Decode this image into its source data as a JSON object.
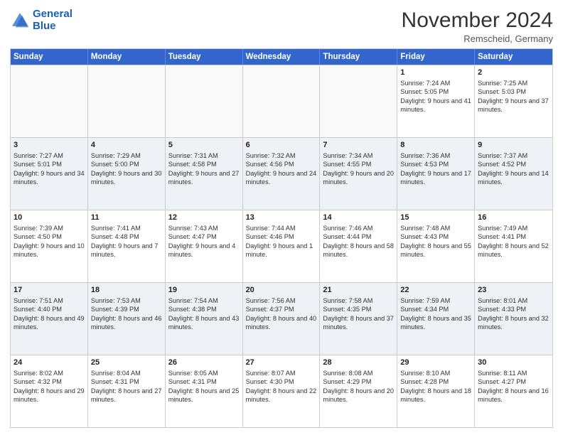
{
  "logo": {
    "line1": "General",
    "line2": "Blue"
  },
  "header": {
    "month": "November 2024",
    "location": "Remscheid, Germany"
  },
  "weekdays": [
    "Sunday",
    "Monday",
    "Tuesday",
    "Wednesday",
    "Thursday",
    "Friday",
    "Saturday"
  ],
  "rows": [
    [
      {
        "day": "",
        "info": "",
        "empty": true
      },
      {
        "day": "",
        "info": "",
        "empty": true
      },
      {
        "day": "",
        "info": "",
        "empty": true
      },
      {
        "day": "",
        "info": "",
        "empty": true
      },
      {
        "day": "",
        "info": "",
        "empty": true
      },
      {
        "day": "1",
        "info": "Sunrise: 7:24 AM\nSunset: 5:05 PM\nDaylight: 9 hours and 41 minutes."
      },
      {
        "day": "2",
        "info": "Sunrise: 7:25 AM\nSunset: 5:03 PM\nDaylight: 9 hours and 37 minutes."
      }
    ],
    [
      {
        "day": "3",
        "info": "Sunrise: 7:27 AM\nSunset: 5:01 PM\nDaylight: 9 hours and 34 minutes."
      },
      {
        "day": "4",
        "info": "Sunrise: 7:29 AM\nSunset: 5:00 PM\nDaylight: 9 hours and 30 minutes."
      },
      {
        "day": "5",
        "info": "Sunrise: 7:31 AM\nSunset: 4:58 PM\nDaylight: 9 hours and 27 minutes."
      },
      {
        "day": "6",
        "info": "Sunrise: 7:32 AM\nSunset: 4:56 PM\nDaylight: 9 hours and 24 minutes."
      },
      {
        "day": "7",
        "info": "Sunrise: 7:34 AM\nSunset: 4:55 PM\nDaylight: 9 hours and 20 minutes."
      },
      {
        "day": "8",
        "info": "Sunrise: 7:36 AM\nSunset: 4:53 PM\nDaylight: 9 hours and 17 minutes."
      },
      {
        "day": "9",
        "info": "Sunrise: 7:37 AM\nSunset: 4:52 PM\nDaylight: 9 hours and 14 minutes."
      }
    ],
    [
      {
        "day": "10",
        "info": "Sunrise: 7:39 AM\nSunset: 4:50 PM\nDaylight: 9 hours and 10 minutes."
      },
      {
        "day": "11",
        "info": "Sunrise: 7:41 AM\nSunset: 4:48 PM\nDaylight: 9 hours and 7 minutes."
      },
      {
        "day": "12",
        "info": "Sunrise: 7:43 AM\nSunset: 4:47 PM\nDaylight: 9 hours and 4 minutes."
      },
      {
        "day": "13",
        "info": "Sunrise: 7:44 AM\nSunset: 4:46 PM\nDaylight: 9 hours and 1 minute."
      },
      {
        "day": "14",
        "info": "Sunrise: 7:46 AM\nSunset: 4:44 PM\nDaylight: 8 hours and 58 minutes."
      },
      {
        "day": "15",
        "info": "Sunrise: 7:48 AM\nSunset: 4:43 PM\nDaylight: 8 hours and 55 minutes."
      },
      {
        "day": "16",
        "info": "Sunrise: 7:49 AM\nSunset: 4:41 PM\nDaylight: 8 hours and 52 minutes."
      }
    ],
    [
      {
        "day": "17",
        "info": "Sunrise: 7:51 AM\nSunset: 4:40 PM\nDaylight: 8 hours and 49 minutes."
      },
      {
        "day": "18",
        "info": "Sunrise: 7:53 AM\nSunset: 4:39 PM\nDaylight: 8 hours and 46 minutes."
      },
      {
        "day": "19",
        "info": "Sunrise: 7:54 AM\nSunset: 4:38 PM\nDaylight: 8 hours and 43 minutes."
      },
      {
        "day": "20",
        "info": "Sunrise: 7:56 AM\nSunset: 4:37 PM\nDaylight: 8 hours and 40 minutes."
      },
      {
        "day": "21",
        "info": "Sunrise: 7:58 AM\nSunset: 4:35 PM\nDaylight: 8 hours and 37 minutes."
      },
      {
        "day": "22",
        "info": "Sunrise: 7:59 AM\nSunset: 4:34 PM\nDaylight: 8 hours and 35 minutes."
      },
      {
        "day": "23",
        "info": "Sunrise: 8:01 AM\nSunset: 4:33 PM\nDaylight: 8 hours and 32 minutes."
      }
    ],
    [
      {
        "day": "24",
        "info": "Sunrise: 8:02 AM\nSunset: 4:32 PM\nDaylight: 8 hours and 29 minutes."
      },
      {
        "day": "25",
        "info": "Sunrise: 8:04 AM\nSunset: 4:31 PM\nDaylight: 8 hours and 27 minutes."
      },
      {
        "day": "26",
        "info": "Sunrise: 8:05 AM\nSunset: 4:31 PM\nDaylight: 8 hours and 25 minutes."
      },
      {
        "day": "27",
        "info": "Sunrise: 8:07 AM\nSunset: 4:30 PM\nDaylight: 8 hours and 22 minutes."
      },
      {
        "day": "28",
        "info": "Sunrise: 8:08 AM\nSunset: 4:29 PM\nDaylight: 8 hours and 20 minutes."
      },
      {
        "day": "29",
        "info": "Sunrise: 8:10 AM\nSunset: 4:28 PM\nDaylight: 8 hours and 18 minutes."
      },
      {
        "day": "30",
        "info": "Sunrise: 8:11 AM\nSunset: 4:27 PM\nDaylight: 8 hours and 16 minutes."
      }
    ]
  ]
}
